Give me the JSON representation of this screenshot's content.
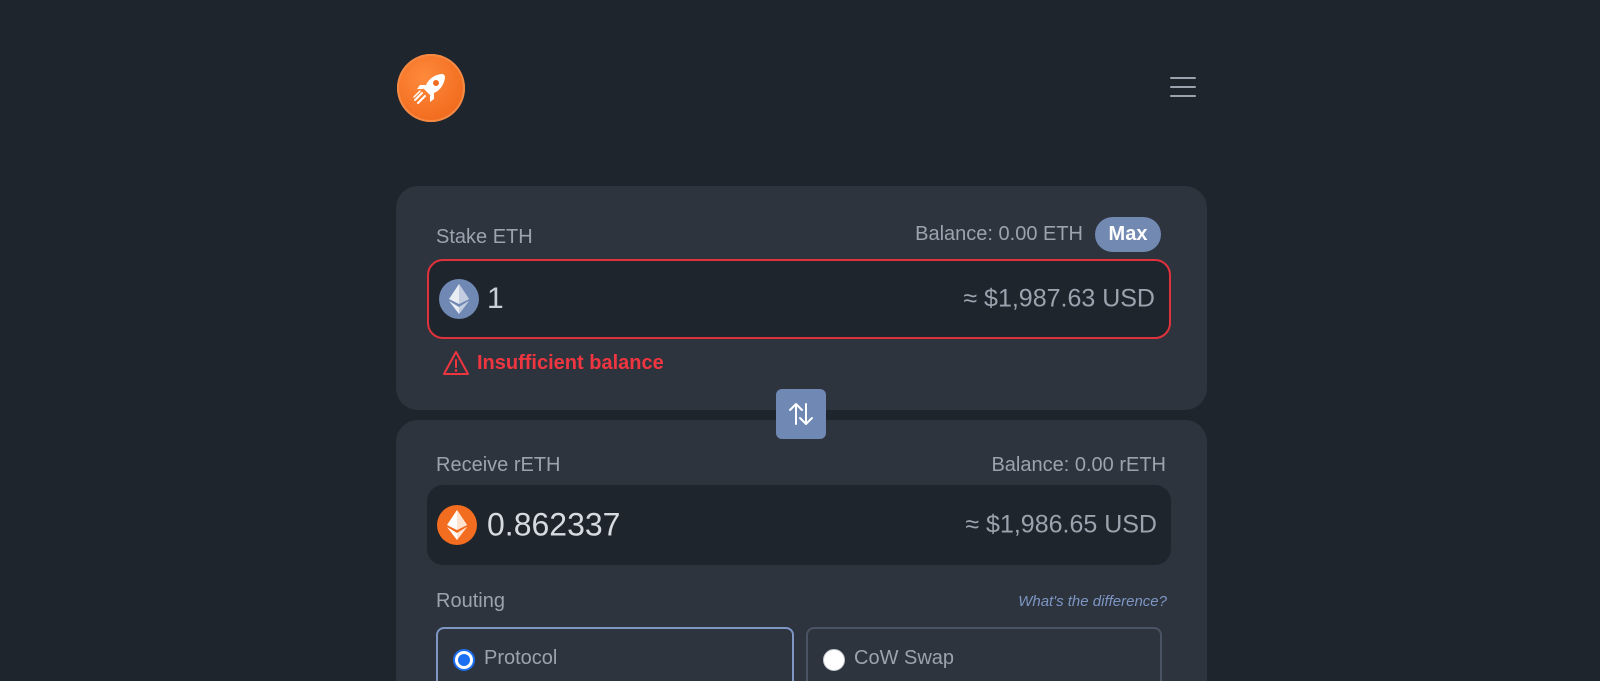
{
  "header": {
    "logo_icon": "rocket-icon",
    "menu_icon": "hamburger-menu-icon"
  },
  "stake": {
    "label": "Stake ETH",
    "balance": "Balance: 0.00 ETH",
    "max_label": "Max",
    "token_icon": "eth-icon",
    "amount": "1",
    "usd_value": "≈  $1,987.63 USD",
    "error": "Insufficient balance"
  },
  "swap_icon": "swap-arrows-icon",
  "receive": {
    "label": "Receive rETH",
    "balance": "Balance: 0.00 rETH",
    "token_icon": "reth-icon",
    "amount": "0.862337",
    "usd_value": "≈  $1,986.65 USD"
  },
  "routing": {
    "label": "Routing",
    "help_link": "What's the difference?",
    "options": [
      {
        "label": "Protocol",
        "selected": true
      },
      {
        "label": "CoW Swap",
        "selected": false
      }
    ]
  },
  "colors": {
    "background": "#1f252d",
    "card": "#2d343e",
    "accent": "#6f88b4",
    "brand": "#f26d1f",
    "error": "#ef3640"
  }
}
